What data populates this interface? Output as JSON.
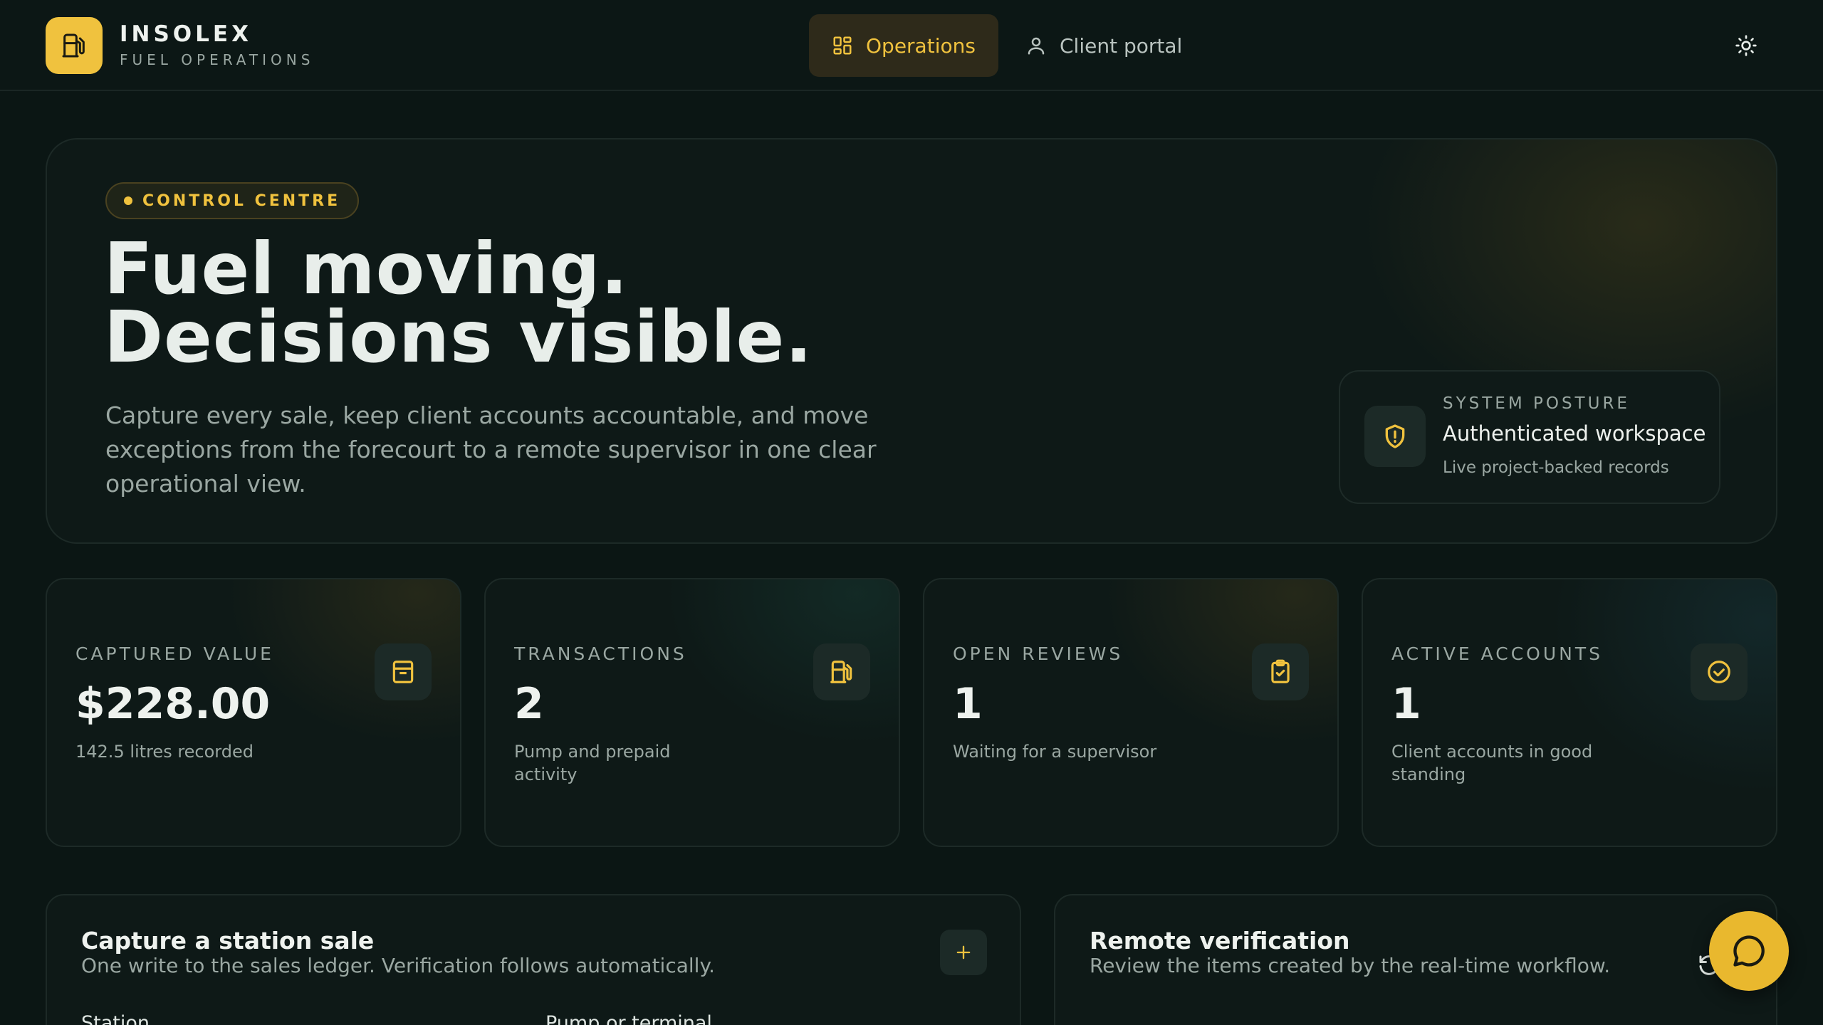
{
  "brand": {
    "name": "INSOLEX",
    "subtitle": "FUEL OPERATIONS",
    "icon": "fuel-pump-icon"
  },
  "nav": {
    "operations": {
      "label": "Operations",
      "icon": "grid-icon",
      "active": true
    },
    "client_portal": {
      "label": "Client portal",
      "icon": "user-icon",
      "active": false
    },
    "theme_toggle_icon": "sun-icon"
  },
  "hero": {
    "tag": "CONTROL CENTRE",
    "title_line1": "Fuel moving.",
    "title_line2": "Decisions visible.",
    "description": "Capture every sale, keep client accounts accountable, and move exceptions from the forecourt to a remote supervisor in one clear operational view.",
    "posture": {
      "label": "SYSTEM POSTURE",
      "title": "Authenticated workspace",
      "subtitle": "Live project-backed records",
      "icon": "shield-alert-icon"
    }
  },
  "stats": [
    {
      "label": "CAPTURED VALUE",
      "value": "$228.00",
      "sub": "142.5 litres recorded",
      "icon": "receipt-box-icon"
    },
    {
      "label": "TRANSACTIONS",
      "value": "2",
      "sub": "Pump and prepaid activity",
      "icon": "fuel-pump-icon"
    },
    {
      "label": "OPEN REVIEWS",
      "value": "1",
      "sub": "Waiting for a supervisor",
      "icon": "clipboard-check-icon"
    },
    {
      "label": "ACTIVE ACCOUNTS",
      "value": "1",
      "sub": "Client accounts in good standing",
      "icon": "check-circle-icon"
    }
  ],
  "capture_panel": {
    "title": "Capture a station sale",
    "subtitle": "One write to the sales ledger. Verification follows automatically.",
    "field_station": "Station",
    "field_pump": "Pump or terminal",
    "add_icon": "plus-icon"
  },
  "verification_panel": {
    "title": "Remote verification",
    "subtitle": "Review the items created by the real-time workflow.",
    "refresh_icon": "refresh-icon"
  },
  "chat": {
    "icon": "chat-bubble-icon"
  },
  "colors": {
    "background": "#0b1614",
    "accent": "#f0c23e",
    "muted_text": "#9aa7a2",
    "card_border": "#1d2a27"
  }
}
